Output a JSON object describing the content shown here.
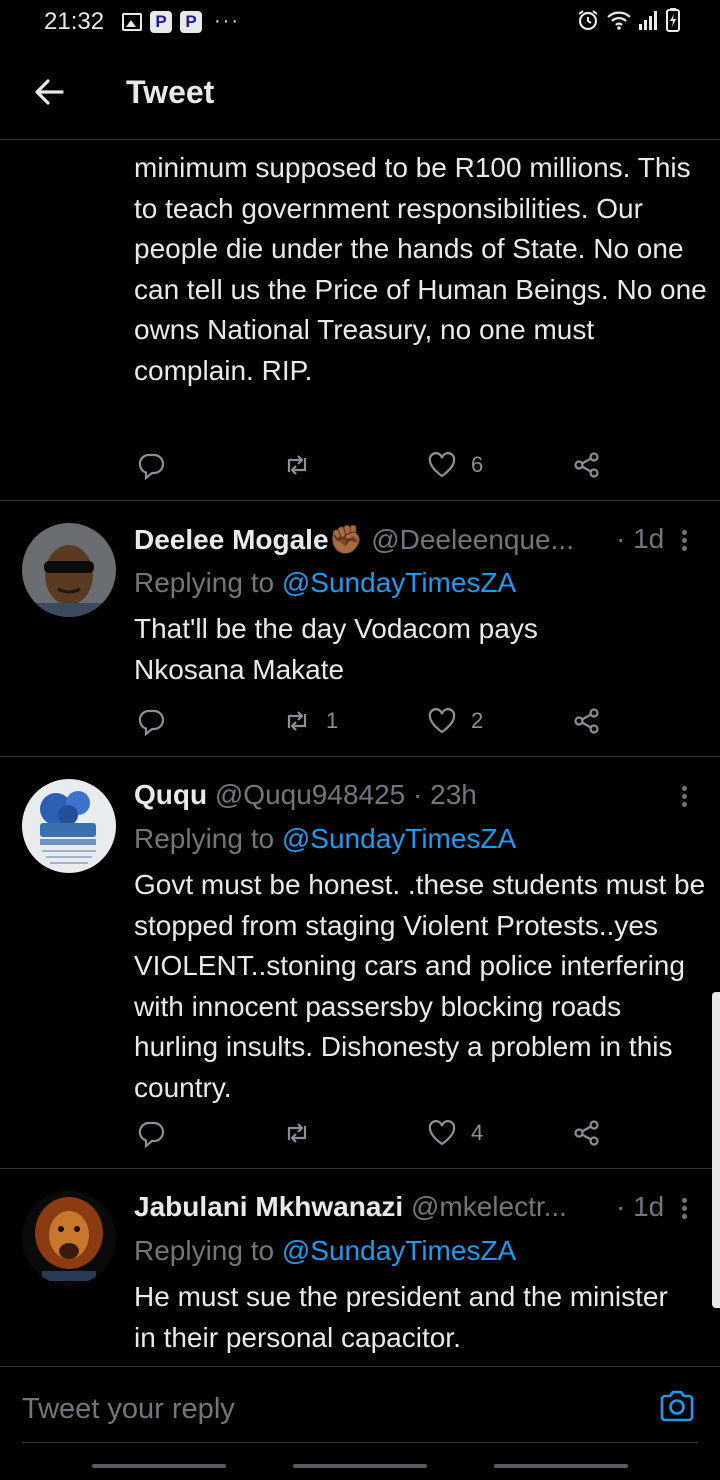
{
  "status_bar": {
    "time": "21:32",
    "left_icons": [
      "image-icon",
      "p-app-icon",
      "p-app-icon",
      "more-dots"
    ],
    "p_glyph": "P",
    "dots": "···",
    "right_icons": [
      "alarm-icon",
      "wifi-icon",
      "signal-icon",
      "battery-icon"
    ]
  },
  "header": {
    "title": "Tweet",
    "back_icon": "arrow-left-icon"
  },
  "colors": {
    "background": "#000000",
    "link": "#1d9bf0",
    "muted": "#71767b",
    "text": "#e7e9ea",
    "divider": "#2f3336"
  },
  "tweets": [
    {
      "partial": true,
      "body": "minimum supposed to be R100 millions. This to teach government responsibilities. Our people die under the hands of State. No one can tell us the Price of Human Beings. No one owns National Treasury, no one must complain. RIP.",
      "retweets": "",
      "likes": "6"
    },
    {
      "name": "Deelee Mogale",
      "emoji": "✊🏾",
      "handle": "@Deeleenque...",
      "time": "· 1d",
      "replying_prefix": "Replying to",
      "replying_to": "@SundayTimesZA",
      "body": "That'll be the day Vodacom pays Nkosana Makate",
      "retweets": "1",
      "likes": "2"
    },
    {
      "name": "Ququ",
      "handle": "@Ququ948425",
      "time": "· 23h",
      "replying_prefix": "Replying to",
      "replying_to": "@SundayTimesZA",
      "body": "Govt must be honest. .these students must be stopped from staging Violent Protests..yes VIOLENT..stoning cars and police interfering with innocent passersby  blocking roads hurling insults. Dishonesty a problem in this country.",
      "retweets": "",
      "likes": "4"
    },
    {
      "name": "Jabulani Mkhwanazi",
      "handle": "@mkelectr...",
      "time": "· 1d",
      "replying_prefix": "Replying to",
      "replying_to": "@SundayTimesZA",
      "body": "He must sue the president and the minister in their personal capacitor."
    }
  ],
  "reply_box": {
    "placeholder": "Tweet your reply",
    "camera_icon": "camera-icon"
  }
}
